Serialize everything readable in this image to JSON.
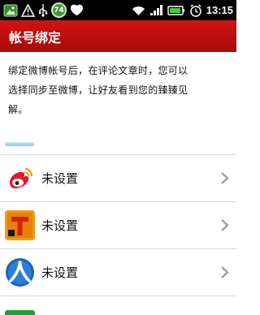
{
  "status_bar": {
    "time": "13:15",
    "battery_badge": "74",
    "icons": [
      "image-icon",
      "warning-icon",
      "usb-icon",
      "badge-icon",
      "shield-icon",
      "wifi-icon",
      "signal-icon",
      "battery-icon",
      "alarm-icon"
    ]
  },
  "title_bar": {
    "title": "帐号绑定"
  },
  "description": "绑定微博帐号后，在评论文章时，您可以\n选择同步至微博，让好友看到您的臻臻见\n解。",
  "accounts": [
    {
      "icon": "weibo-icon",
      "label": "未设置"
    },
    {
      "icon": "tencent-weibo-icon",
      "label": "未设置"
    },
    {
      "icon": "renren-icon",
      "label": "未设置"
    }
  ],
  "colors": {
    "title_bar": "#c00f0f",
    "status_bar": "#000000",
    "separator": "#8cc9e8"
  }
}
